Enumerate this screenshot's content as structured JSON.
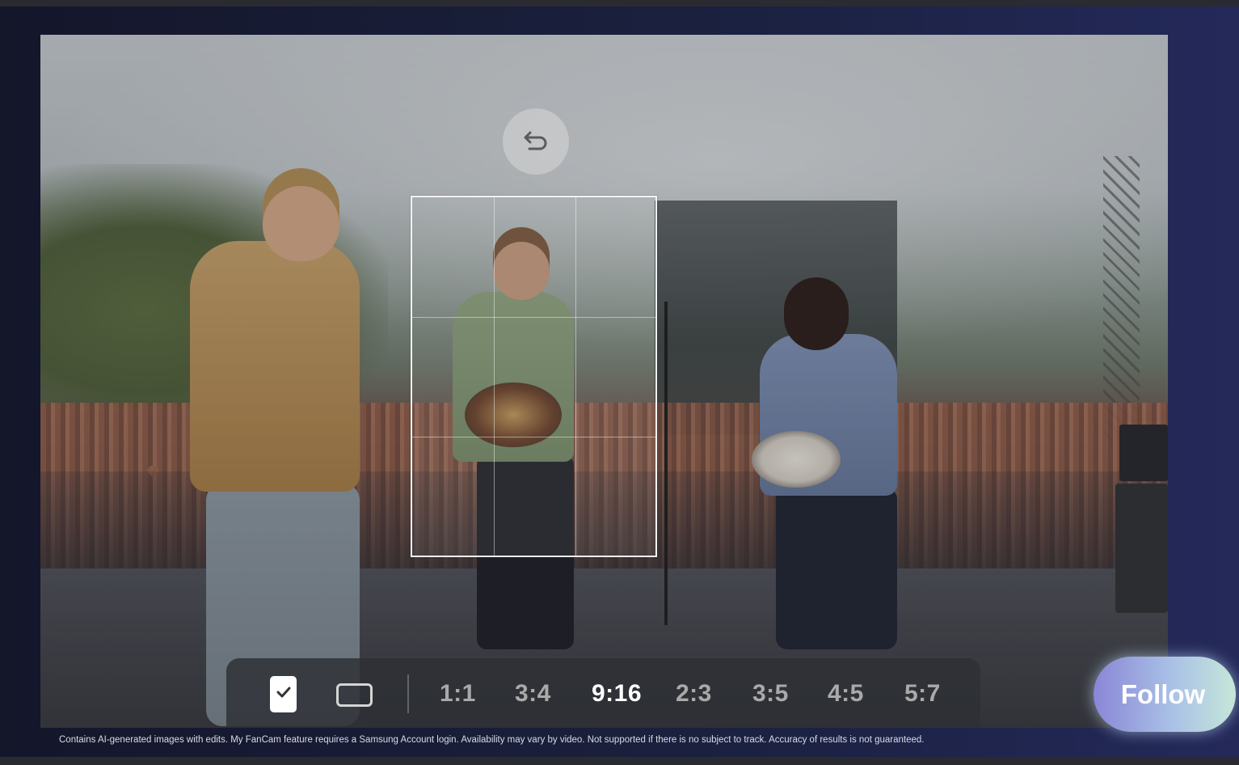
{
  "undo": {
    "icon": "undo-icon"
  },
  "toolbar": {
    "check_icon": "checkmark-icon",
    "rect_icon": "rectangle-frame-icon",
    "ratios": [
      {
        "label": "1:1",
        "selected": false
      },
      {
        "label": "3:4",
        "selected": false
      },
      {
        "label": "9:16",
        "selected": true
      },
      {
        "label": "2:3",
        "selected": false
      },
      {
        "label": "3:5",
        "selected": false
      },
      {
        "label": "4:5",
        "selected": false
      },
      {
        "label": "5:7",
        "selected": false
      }
    ]
  },
  "follow": {
    "label": "Follow"
  },
  "disclaimer": "Contains AI-generated images with edits. My FanCam feature requires a Samsung Account login. Availability may vary by video. Not supported if there is no subject to track. Accuracy of results is not guaranteed.",
  "colors": {
    "selected_ratio": "#ffffff",
    "unselected_ratio": "#a9a9a9",
    "follow_gradient_start": "#8a86d6",
    "follow_gradient_end": "#c6e6d9"
  }
}
